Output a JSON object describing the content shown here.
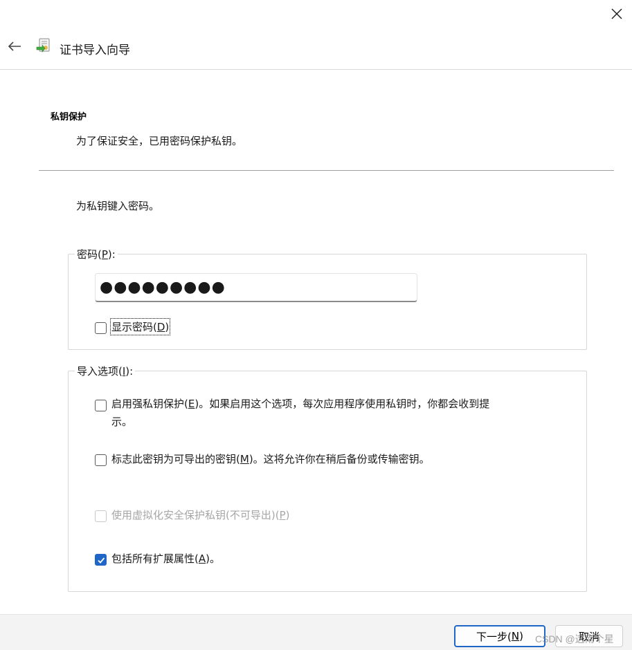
{
  "window": {
    "title": "证书导入向导",
    "close_icon": "close-icon",
    "back_icon": "back-arrow-icon",
    "wizard_icon": "certificate-import-icon"
  },
  "page": {
    "heading": "私钥保护",
    "description": "为了保证安全，已用密码保护私钥。",
    "prompt": "为私钥键入密码。"
  },
  "password_group": {
    "legend_pre": "密码(",
    "legend_key": "P",
    "legend_post": "):",
    "value": "●●●●●●●●●",
    "show_password": {
      "label_pre": "显示密码(",
      "label_key": "D",
      "label_post": ")",
      "checked": false
    }
  },
  "options_group": {
    "legend_pre": "导入选项(",
    "legend_key": "I",
    "legend_post": "):",
    "options": [
      {
        "line1_pre": "启用强私钥保护(",
        "line1_key": "E",
        "line1_post": ")。如果启用这个选项，每次应用程序使用私钥时，你都会收到提",
        "line2": "示。",
        "checked": false,
        "enabled": true
      },
      {
        "pre": "标志此密钥为可导出的密钥(",
        "key": "M",
        "post": ")。这将允许你在稍后备份或传输密钥。",
        "checked": false,
        "enabled": true
      },
      {
        "pre": "使用虚拟化安全保护私钥(不可导出)(",
        "key": "P",
        "post": ")",
        "checked": false,
        "enabled": false
      },
      {
        "pre": "包括所有扩展属性(",
        "key": "A",
        "post": ")。",
        "checked": true,
        "enabled": true
      }
    ]
  },
  "footer": {
    "next_pre": "下一步(",
    "next_key": "N",
    "next_post": ")",
    "cancel": "取消"
  },
  "watermark": "CSDN @这南个星",
  "colors": {
    "accent": "#1f66c7",
    "separator": "#a0a0a0",
    "disabled_text": "#a6a6a6"
  }
}
